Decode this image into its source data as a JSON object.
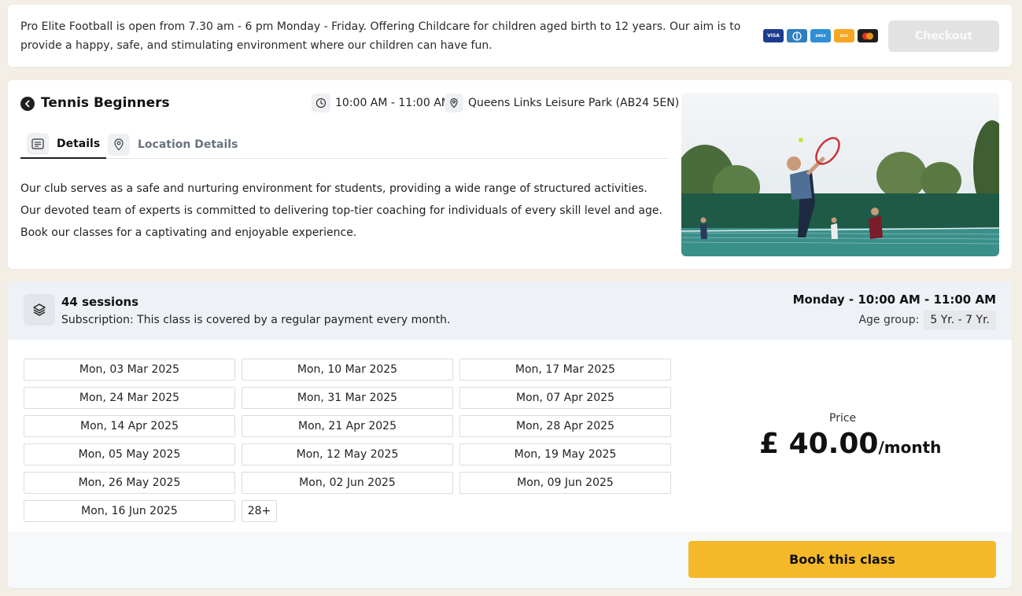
{
  "banner": {
    "info": "Pro Elite Football is open from 7.30 am - 6 pm Monday - Friday. Offering Childcare for children aged birth to 12 years. Our aim is to provide a happy, safe, and stimulating environment where our children can have fun.",
    "payment_icons": [
      "visa-card-icon",
      "diners-card-icon",
      "amex-card-icon",
      "discover-card-icon",
      "mastercard-icon"
    ],
    "checkout_label": "Checkout"
  },
  "class": {
    "title": "Tennis Beginners",
    "time": "10:00 AM - 11:00 AM",
    "location": "Queens Links Leisure Park (AB24 5EN)",
    "tabs": [
      {
        "label": "Details",
        "icon": "details-icon"
      },
      {
        "label": "Location Details",
        "icon": "map-pin-icon"
      }
    ],
    "description": "Our club serves as a safe and nurturing environment for students, providing a wide range of structured activities. Our devoted team of experts is committed to delivering top-tier coaching for individuals of every skill level and age. Book our classes for a captivating and enjoyable experience."
  },
  "sessions": {
    "count": "44 sessions",
    "subscription": "Subscription: This class is covered by a regular payment every month.",
    "schedule": "Monday - 10:00 AM - 11:00 AM",
    "age_label": "Age group:",
    "age_value": "5 Yr. - 7 Yr.",
    "dates": [
      "Mon, 03 Mar 2025",
      "Mon, 10 Mar 2025",
      "Mon, 17 Mar 2025",
      "Mon, 24 Mar 2025",
      "Mon, 31 Mar 2025",
      "Mon, 07 Apr 2025",
      "Mon, 14 Apr 2025",
      "Mon, 21 Apr 2025",
      "Mon, 28 Apr 2025",
      "Mon, 05 May 2025",
      "Mon, 12 May 2025",
      "Mon, 19 May 2025",
      "Mon, 26 May 2025",
      "Mon, 02 Jun 2025",
      "Mon, 09 Jun 2025",
      "Mon, 16 Jun 2025"
    ],
    "more": "28+",
    "price_label": "Price",
    "price": "£ 40.00",
    "price_period": "/month",
    "book_label": "Book this class"
  },
  "colors": {
    "accent": "#f4b829",
    "background": "#f3efe6",
    "header_band": "#eef2f7"
  }
}
